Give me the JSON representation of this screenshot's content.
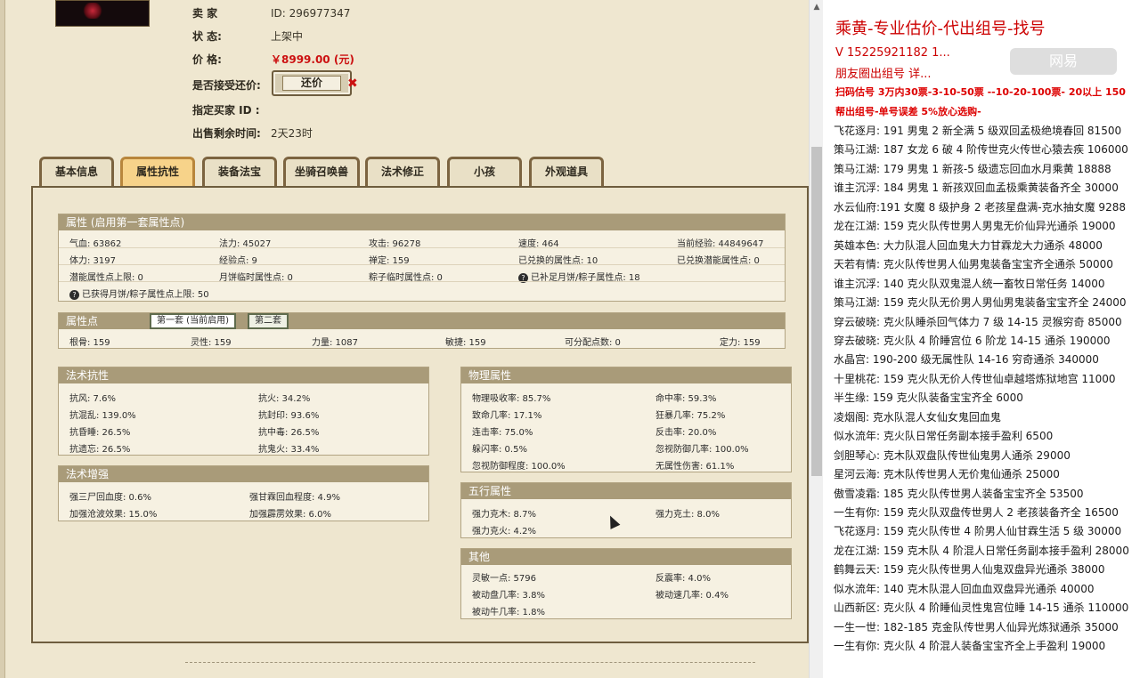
{
  "seller_info": {
    "seller_label": "卖 家",
    "seller_value": "ID: 296977347",
    "status_label": "状 态:",
    "status_value": "上架中",
    "price_label": "价 格:",
    "price_value": "￥8999.00 (元)",
    "counter_label": "是否接受还价:",
    "counter_button": "还价",
    "buyer_label": "指定买家 ID :",
    "time_label": "出售剩余时间:",
    "time_value": "2天23时"
  },
  "tabs": [
    "基本信息",
    "属性抗性",
    "装备法宝",
    "坐骑召唤兽",
    "法术修正",
    "小孩",
    "外观道具"
  ],
  "active_tab": "属性抗性",
  "attributes": {
    "title": "属性 (启用第一套属性点)",
    "rows": [
      [
        "气血: 63862",
        "法力: 45027",
        "攻击: 96278",
        "速度: 464",
        "当前经验: 44849647"
      ],
      [
        "体力: 3197",
        "经验点: 9",
        "禅定: 159",
        "已兑换的属性点: 10",
        "已兑换潜能属性点: 0"
      ],
      [
        "潜能属性点上限: 0",
        "月饼临时属性点: 0",
        "粽子临时属性点: 0",
        "已补足月饼/粽子属性点: 18",
        ""
      ]
    ],
    "note": "已获得月饼/粽子属性点上限: 50"
  },
  "points": {
    "title": "属性点",
    "subtab_1": "第一套 (当前启用)",
    "subtab_2": "第二套",
    "values": [
      "根骨: 159",
      "灵性: 159",
      "力量: 1087",
      "敏捷: 159",
      "可分配点数: 0",
      "定力: 159"
    ]
  },
  "spell_resist": {
    "title": "法术抗性",
    "rows": [
      [
        "抗风: 7.6%",
        "抗火: 34.2%"
      ],
      [
        "抗混乱: 139.0%",
        "抗封印: 93.6%"
      ],
      [
        "抗昏睡: 26.5%",
        "抗中毒: 26.5%"
      ],
      [
        "抗遗忘: 26.5%",
        "抗鬼火: 33.4%"
      ]
    ]
  },
  "spell_boost": {
    "title": "法术增强",
    "rows": [
      [
        "强三尸回血度: 0.6%",
        "强甘霖回血程度: 4.9%"
      ],
      [
        "加强沧波效果: 15.0%",
        "加强霹雳效果: 6.0%"
      ]
    ]
  },
  "physical": {
    "title": "物理属性",
    "rows": [
      [
        "物理吸收率: 85.7%",
        "命中率: 59.3%"
      ],
      [
        "致命几率: 17.1%",
        "狂暴几率: 75.2%"
      ],
      [
        "连击率: 75.0%",
        "反击率: 20.0%"
      ],
      [
        "躲闪率: 0.5%",
        "忽视防御几率: 100.0%"
      ],
      [
        "忽视防御程度: 100.0%",
        "无属性伤害: 61.1%"
      ]
    ]
  },
  "elements": {
    "title": "五行属性",
    "rows": [
      [
        "强力克木: 8.7%",
        "强力克土: 8.0%"
      ],
      [
        "强力克火: 4.2%",
        ""
      ]
    ]
  },
  "other": {
    "title": "其他",
    "rows": [
      [
        "灵敏一点: 5796",
        "反震率: 4.0%"
      ],
      [
        "被动盘几率: 3.8%",
        "被动速几率: 0.4%"
      ],
      [
        "被动牛几率: 1.8%",
        ""
      ]
    ]
  },
  "doc": {
    "title": "乘黄-专业估价-代出组号-找号",
    "contact": "V 15225921182   1...",
    "line2": "朋友圈出组号    详...",
    "line3": "扫码估号 3万内30票-3-10-50票 --10-20-100票- 20以上 150",
    "line4": "帮出组号-单号误差 5%放心选购-",
    "watermark": "网易",
    "items": [
      "飞花逐月: 191 男鬼 2 新全满 5 级双回孟极绝境春回 81500",
      "策马江湖: 187 女龙 6 破 4 阶传世克火传世心猿去疾 106000",
      "策马江湖: 179 男鬼 1 新孩-5 级遗忘回血水月乘黄 18888",
      "谁主沉浮: 184 男鬼 1 新孩双回血孟极乘黄装备齐全 30000",
      "水云仙府:191 女魔 8 级护身 2 老孩星盘满-克水抽女魔 9288",
      "龙在江湖: 159 克火队传世男人男鬼无价仙异光通杀 19000",
      "英雄本色: 大力队混人回血鬼大力甘霖龙大力通杀 48000",
      "天若有情: 克火队传世男人仙男鬼装备宝宝齐全通杀 50000",
      "谁主沉浮: 140 克火队双鬼混人统一畜牧日常任务 14000",
      "策马江湖: 159 克火队无价男人男仙男鬼装备宝宝齐全 24000",
      "穿云破晓: 克火队睡杀回气体力 7 级 14-15 灵猴穷奇 85000",
      "穿去破晓: 克火队 4 阶睡宫位 6 阶龙 14-15 通杀 190000",
      "水晶宫: 190-200 级无属性队 14-16 穷奇通杀 340000",
      "十里桃花: 159 克火队无价人传世仙卓越塔炼狱地宫 11000",
      "半生缘: 159 克火队装备宝宝齐全 6000",
      "凌烟阁: 克水队混人女仙女鬼回血鬼",
      "似水流年: 克火队日常任务副本接手盈利 6500",
      "剑胆琴心: 克木队双盘队传世仙鬼男人通杀 29000",
      "星河云海: 克木队传世男人无价鬼仙通杀 25000",
      "傲雪凌霜: 185 克火队传世男人装备宝宝齐全 53500",
      "一生有你: 159 克火队双盘传世男人 2 老孩装备齐全 16500",
      "飞花逐月: 159 克火队传世 4 阶男人仙甘霖生活 5 级 30000",
      "龙在江湖: 159 克木队 4 阶混人日常任务副本接手盈利 28000",
      "鹤舞云天: 159 克火队传世男人仙鬼双盘异光通杀 38000",
      "似水流年: 140 克木队混人回血血双盘异光通杀 40000",
      "山西新区: 克火队 4 阶睡仙灵性鬼宫位睡 14-15 通杀 110000",
      "一生一世: 182-185 克金队传世男人仙异光炼狱通杀 35000",
      "一生有你: 克火队 4 阶混人装备宝宝齐全上手盈利 19000"
    ]
  }
}
